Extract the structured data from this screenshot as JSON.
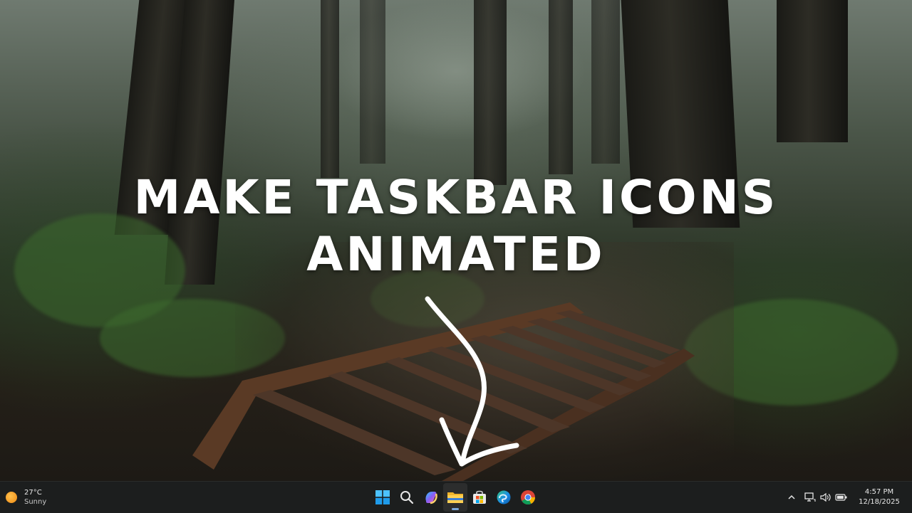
{
  "thumbnail": {
    "title_line1": "MAKE TASKBAR ICONS",
    "title_line2": "ANIMATED"
  },
  "taskbar": {
    "weather": {
      "temperature": "27°C",
      "condition": "Sunny",
      "icon": "sun-icon"
    },
    "apps": [
      {
        "name": "Start",
        "icon": "windows-logo-icon"
      },
      {
        "name": "Search",
        "icon": "search-icon"
      },
      {
        "name": "Copilot",
        "icon": "copilot-icon"
      },
      {
        "name": "File Explorer",
        "icon": "folder-icon",
        "active": true
      },
      {
        "name": "Microsoft Store",
        "icon": "store-icon"
      },
      {
        "name": "Microsoft Edge",
        "icon": "edge-icon"
      },
      {
        "name": "Google Chrome",
        "icon": "chrome-icon"
      }
    ],
    "tray_icons": [
      "chevron-up-icon",
      "network-icon",
      "volume-icon",
      "battery-icon"
    ],
    "clock": {
      "time": "4:57 PM",
      "date": "12/18/2025"
    }
  },
  "colors": {
    "title": "#ffffff",
    "taskbar_bg": "#1c1e1e",
    "active_indicator": "#7aa7d9"
  }
}
